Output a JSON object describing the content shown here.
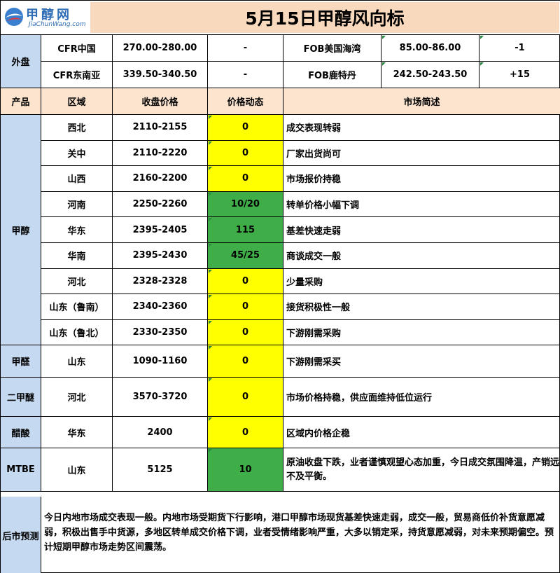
{
  "logo": {
    "cn": "甲醇网",
    "en": "JiaChunWang.com"
  },
  "title": "5月15日甲醇风向标",
  "external": {
    "label": "外盘",
    "rows": [
      {
        "left_name": "CFR中国",
        "left_price": "270.00-280.00",
        "left_change": "-",
        "right_name": "FOB美国海湾",
        "right_price": "85.00-86.00",
        "right_change": "-1"
      },
      {
        "left_name": "CFR东南亚",
        "left_price": "339.50-340.50",
        "left_change": "-",
        "right_name": "FOB鹿特丹",
        "right_price": "242.50-243.50",
        "right_change": "+15"
      }
    ]
  },
  "columns": {
    "product": "产品",
    "region": "区域",
    "price": "收盘价格",
    "change": "价格动态",
    "desc": "市场简述"
  },
  "products": [
    {
      "name": "甲醇",
      "rows": [
        {
          "region": "西北",
          "price": "2110-2155",
          "change": "0",
          "desc": "成交表现转弱",
          "color": "#ffff00"
        },
        {
          "region": "关中",
          "price": "2110-2220",
          "change": "0",
          "desc": "厂家出货尚可",
          "color": "#ffff00"
        },
        {
          "region": "山西",
          "price": "2160-2200",
          "change": "0",
          "desc": "市场报价持稳",
          "color": "#ffff00"
        },
        {
          "region": "河南",
          "price": "2250-2260",
          "change": "10/20",
          "desc": "转单价格小幅下调",
          "color": "#3fae49"
        },
        {
          "region": "华东",
          "price": "2395-2405",
          "change": "115",
          "desc": "基差快速走弱",
          "color": "#3fae49"
        },
        {
          "region": "华南",
          "price": "2395-2430",
          "change": "45/25",
          "desc": "商谈成交一般",
          "color": "#3fae49"
        },
        {
          "region": "河北",
          "price": "2328-2328",
          "change": "0",
          "desc": "少量采购",
          "color": "#ffff00"
        },
        {
          "region": "山东（鲁南）",
          "price": "2340-2360",
          "change": "0",
          "desc": "接货积极性一般",
          "color": "#ffff00"
        },
        {
          "region": "山东（鲁北）",
          "price": "2330-2350",
          "change": "0",
          "desc": "下游刚需采购",
          "color": "#ffff00"
        }
      ]
    },
    {
      "name": "甲醛",
      "rows": [
        {
          "region": "山东",
          "price": "1090-1160",
          "change": "0",
          "desc": "下游刚需采买",
          "color": "#ffff00"
        }
      ]
    },
    {
      "name": "二甲醚",
      "rows": [
        {
          "region": "河北",
          "price": "3570-3720",
          "change": "0",
          "desc": "市场价格持稳，供应面维持低位运行",
          "color": "#ffff00"
        }
      ]
    },
    {
      "name": "醋酸",
      "rows": [
        {
          "region": "华东",
          "price": "2400",
          "change": "0",
          "desc": "区域内价格企稳",
          "color": "#ffff00"
        }
      ]
    },
    {
      "name": "MTBE",
      "rows": [
        {
          "region": "山东",
          "price": "5125",
          "change": "10",
          "desc": "原油收盘下跌，业者谨慎观望心态加重，今日成交氛围降温，产销远不及平衡。",
          "color": "#3fae49"
        }
      ]
    }
  ],
  "forecast": {
    "label": "后市预测",
    "text": "今日内地市场成交表现一般。内地市场受期货下行影响，港口甲醇市场现货基差快速走弱，成交一般，贸易商低价补货意愿减弱，积极出售手中货源，多地区转单成交价格下调，业者受情绪影响严重，大多以销定采，持货意愿减弱，对未来预期偏空。预计短期甲醇市场走势区间震荡。"
  }
}
